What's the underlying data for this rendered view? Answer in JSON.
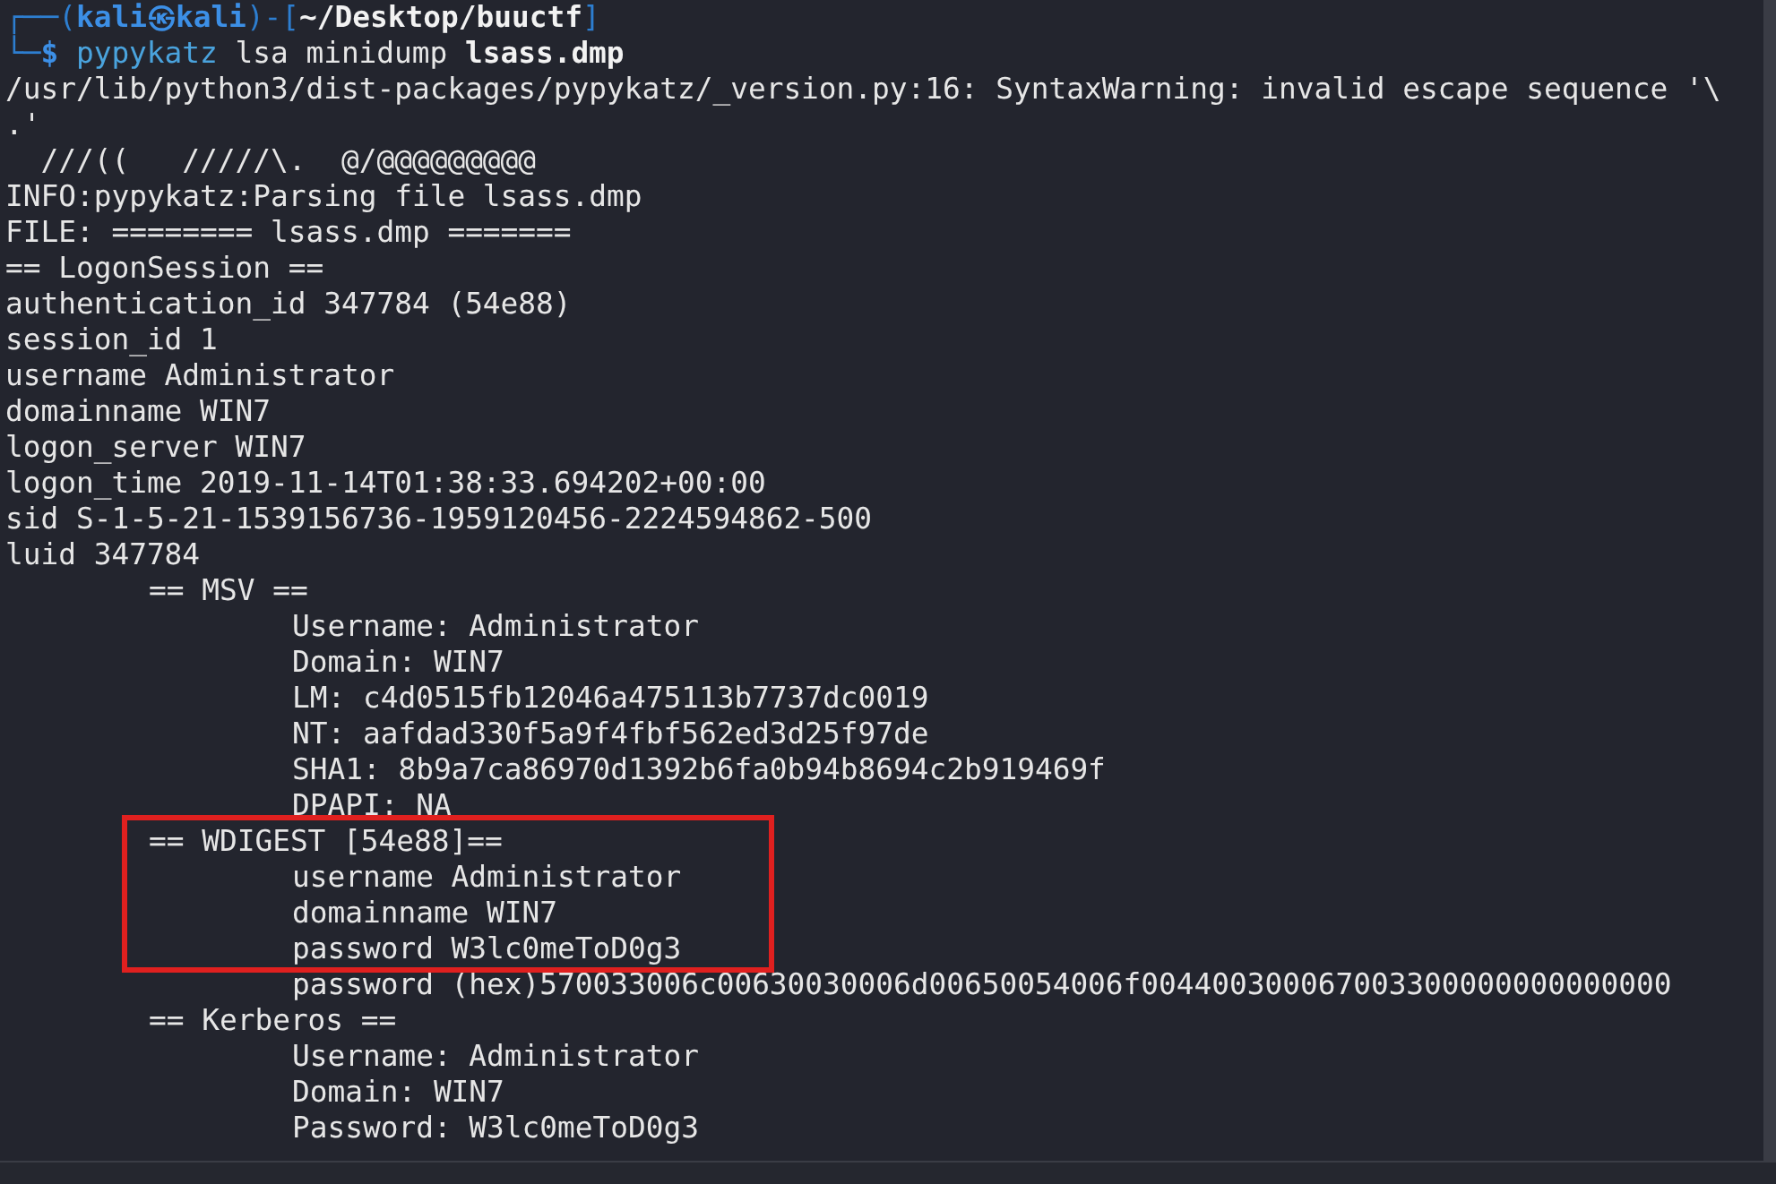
{
  "prompt_lines": [
    [
      {
        "text": "┌──(",
        "kind": "frame"
      },
      {
        "text": "kali㉿kali",
        "kind": "userhost"
      },
      {
        "text": ")-[",
        "kind": "frame"
      },
      {
        "text": "~/Desktop/buuctf",
        "kind": "cwd"
      },
      {
        "text": "]",
        "kind": "frame"
      }
    ],
    [
      {
        "text": "└─",
        "kind": "frame"
      },
      {
        "text": "$",
        "kind": "dollar"
      },
      {
        "text": "pypykatz",
        "kind": "command"
      },
      {
        "text": "lsa minidump",
        "kind": "args"
      },
      {
        "text": "lsass.dmp",
        "kind": "file"
      }
    ]
  ],
  "output": [
    {
      "text": "/usr/lib/python3/dist-packages/pypykatz/_version.py:16: SyntaxWarning: invalid escape sequence '\\"
    },
    {
      "text": ".'"
    },
    {
      "text": "  ///((   /////\\.  @/@@@@@@@@@"
    },
    {
      "text": "INFO:pypykatz:Parsing file lsass.dmp"
    },
    {
      "text": "FILE: ======== lsass.dmp ======="
    },
    {
      "text": "== LogonSession =="
    },
    {
      "text": "authentication_id 347784 (54e88)"
    },
    {
      "text": "session_id 1"
    },
    {
      "text": "username Administrator"
    },
    {
      "text": "domainname WIN7"
    },
    {
      "text": "logon_server WIN7"
    },
    {
      "text": "logon_time 2019-11-14T01:38:33.694202+00:00"
    },
    {
      "text": "sid S-1-5-21-1539156736-1959120456-2224594862-500"
    },
    {
      "text": "luid 347784",
      "children": [
        {
          "text": "== MSV ==",
          "children": [
            {
              "text": "Username: Administrator"
            },
            {
              "text": "Domain: WIN7"
            },
            {
              "text": "LM: c4d0515fb12046a475113b7737dc0019"
            },
            {
              "text": "NT: aafdad330f5a9f4fbf562ed3d25f97de"
            },
            {
              "text": "SHA1: 8b9a7ca86970d1392b6fa0b94b8694c2b919469f"
            },
            {
              "text": "DPAPI: NA"
            }
          ]
        },
        {
          "text": "== WDIGEST [54e88]==",
          "highlighted": true,
          "children": [
            {
              "text": "username Administrator",
              "highlighted": true
            },
            {
              "text": "domainname WIN7",
              "highlighted": true
            },
            {
              "text": "password W3lc0meToD0g3",
              "highlighted": true
            },
            {
              "text": "password (hex)570033006c00630030006d00650054006f004400300067003300000000000000"
            }
          ]
        },
        {
          "text": "== Kerberos ==",
          "children": [
            {
              "text": "Username: Administrator"
            },
            {
              "text": "Domain: WIN7"
            },
            {
              "text": "Password: W3lc0meToD0g3"
            }
          ]
        }
      ]
    }
  ]
}
